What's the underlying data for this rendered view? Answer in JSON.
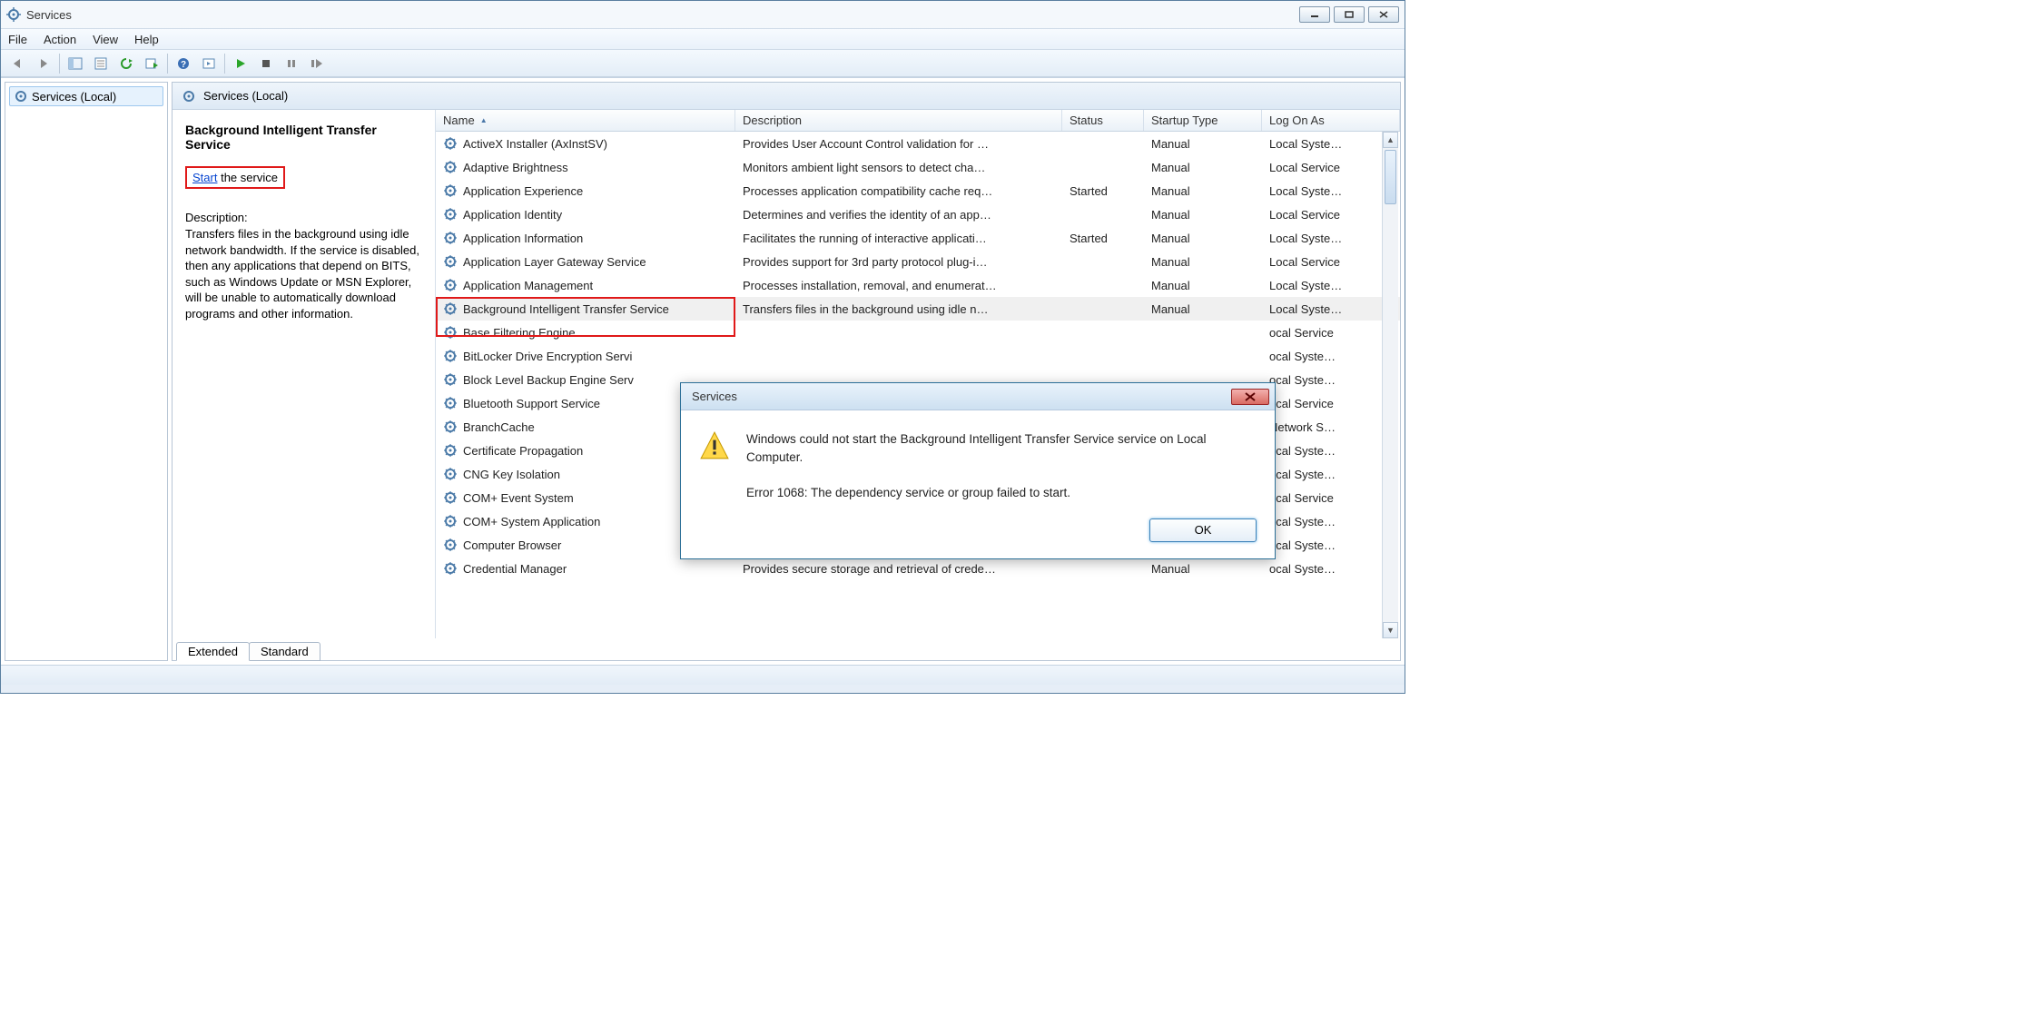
{
  "window": {
    "title": "Services"
  },
  "menus": {
    "file": "File",
    "action": "Action",
    "view": "View",
    "help": "Help"
  },
  "tree": {
    "root": "Services (Local)"
  },
  "right_header": "Services (Local)",
  "columns": {
    "name": "Name",
    "desc": "Description",
    "status": "Status",
    "startup": "Startup Type",
    "logon": "Log On As"
  },
  "detail": {
    "selected_name": "Background Intelligent Transfer Service",
    "start_link": "Start",
    "start_suffix": " the service",
    "desc_label": "Description:",
    "desc_text": "Transfers files in the background using idle network bandwidth. If the service is disabled, then any applications that depend on BITS, such as Windows Update or MSN Explorer, will be unable to automatically download programs and other information."
  },
  "services": [
    {
      "name": "ActiveX Installer (AxInstSV)",
      "desc": "Provides User Account Control validation for …",
      "status": "",
      "startup": "Manual",
      "logon": "Local Syste…"
    },
    {
      "name": "Adaptive Brightness",
      "desc": "Monitors ambient light sensors to detect cha…",
      "status": "",
      "startup": "Manual",
      "logon": "Local Service"
    },
    {
      "name": "Application Experience",
      "desc": "Processes application compatibility cache req…",
      "status": "Started",
      "startup": "Manual",
      "logon": "Local Syste…"
    },
    {
      "name": "Application Identity",
      "desc": "Determines and verifies the identity of an app…",
      "status": "",
      "startup": "Manual",
      "logon": "Local Service"
    },
    {
      "name": "Application Information",
      "desc": "Facilitates the running of interactive applicati…",
      "status": "Started",
      "startup": "Manual",
      "logon": "Local Syste…"
    },
    {
      "name": "Application Layer Gateway Service",
      "desc": "Provides support for 3rd party protocol plug-i…",
      "status": "",
      "startup": "Manual",
      "logon": "Local Service"
    },
    {
      "name": "Application Management",
      "desc": "Processes installation, removal, and enumerat…",
      "status": "",
      "startup": "Manual",
      "logon": "Local Syste…"
    },
    {
      "name": "Background Intelligent Transfer Service",
      "desc": "Transfers files in the background using idle n…",
      "status": "",
      "startup": "Manual",
      "logon": "Local Syste…",
      "selected": true
    },
    {
      "name": "Base Filtering Engine",
      "desc": "",
      "status": "",
      "startup": "",
      "logon": "ocal Service"
    },
    {
      "name": "BitLocker Drive Encryption Servi",
      "desc": "",
      "status": "",
      "startup": "",
      "logon": "ocal Syste…"
    },
    {
      "name": "Block Level Backup Engine Serv",
      "desc": "",
      "status": "",
      "startup": "",
      "logon": "ocal Syste…"
    },
    {
      "name": "Bluetooth Support Service",
      "desc": "",
      "status": "",
      "startup": "",
      "logon": "ocal Service"
    },
    {
      "name": "BranchCache",
      "desc": "",
      "status": "",
      "startup": "",
      "logon": "Network S…"
    },
    {
      "name": "Certificate Propagation",
      "desc": "",
      "status": "",
      "startup": "",
      "logon": "ocal Syste…"
    },
    {
      "name": "CNG Key Isolation",
      "desc": "",
      "status": "",
      "startup": "",
      "logon": "ocal Syste…"
    },
    {
      "name": "COM+ Event System",
      "desc": "",
      "status": "",
      "startup": "",
      "logon": "ocal Service"
    },
    {
      "name": "COM+ System Application",
      "desc": "",
      "status": "",
      "startup": "",
      "logon": "ocal Syste…"
    },
    {
      "name": "Computer Browser",
      "desc": "",
      "status": "",
      "startup": "",
      "logon": "ocal Syste…"
    },
    {
      "name": "Credential Manager",
      "desc": "Provides secure storage and retrieval of crede…",
      "status": "",
      "startup": "Manual",
      "logon": "ocal Syste…"
    }
  ],
  "tabs": {
    "extended": "Extended",
    "standard": "Standard"
  },
  "dialog": {
    "title": "Services",
    "line1": "Windows could not start the Background Intelligent Transfer Service service on Local Computer.",
    "line2": "Error 1068: The dependency service or group failed to start.",
    "ok": "OK"
  }
}
